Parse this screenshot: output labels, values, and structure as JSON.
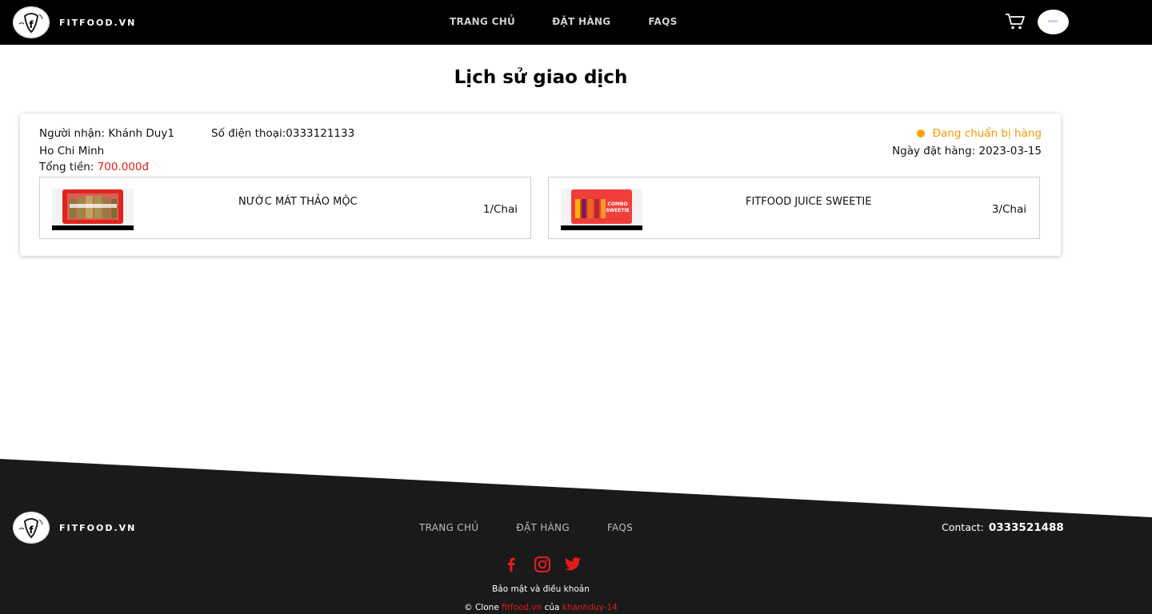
{
  "brand": {
    "name": "FITFOOD.VN"
  },
  "header": {
    "nav": [
      "TRANG CHỦ",
      "ĐẶT HÀNG",
      "FAQS"
    ]
  },
  "page": {
    "title": "Lịch sử giao dịch"
  },
  "order": {
    "recipient_label": "Người nhận: ",
    "recipient": "Khánh Duy1",
    "phone_label": "Số điện thoại:",
    "phone": "0333121133",
    "address": "Ho Chi Minh",
    "total_label": "Tổng tiền: ",
    "total": "700.000đ",
    "status": "Đang chuẩn bị hàng",
    "date_label": "Ngày đặt hàng: ",
    "date": "2023-03-15",
    "items": [
      {
        "name": "NƯỚC MÁT THẢO MỘC",
        "qty": "1/Chai"
      },
      {
        "name": "FITFOOD JUICE SWEETIE",
        "qty": "3/Chai"
      }
    ]
  },
  "footer": {
    "nav": [
      "TRANG CHỦ",
      "ĐẶT HÀNG",
      "FAQS"
    ],
    "contact_label": "Contact:",
    "contact_phone": "0333521488",
    "legal": "Bảo mật và điều khoản",
    "copyright_prefix": "© Clone ",
    "copyright_site": "fitfood.vn",
    "copyright_mid": " của ",
    "copyright_author": "khanhduy-14"
  },
  "colors": {
    "accent_red": "#e21b1b",
    "status_orange": "#f29a00",
    "header_bg": "#000000",
    "footer_bg": "#1a1a1a"
  },
  "icons": [
    "fitfood-logo-icon",
    "cart-icon",
    "avatar",
    "facebook-icon",
    "instagram-icon",
    "twitter-icon"
  ]
}
